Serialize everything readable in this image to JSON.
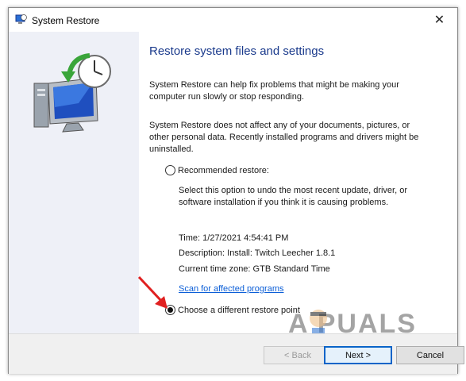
{
  "window": {
    "title": "System Restore",
    "close_glyph": "✕",
    "icon": "system-restore-icon"
  },
  "content": {
    "heading": "Restore system files and settings",
    "paragraph1": "System Restore can help fix problems that might be making your computer run slowly or stop responding.",
    "paragraph2": "System Restore does not affect any of your documents, pictures, or other personal data. Recently installed programs and drivers might be uninstalled.",
    "recommended": {
      "label": "Recommended restore:",
      "selected": false,
      "description": "Select this option to undo the most recent update, driver, or software installation if you think it is causing problems.",
      "time": "Time: 1/27/2021 4:54:41 PM",
      "desc_line": "Description: Install: Twitch Leecher 1.8.1",
      "timezone": "Current time zone: GTB Standard Time",
      "scan_link": "Scan for affected programs"
    },
    "different": {
      "label": "Choose a different restore point",
      "selected": true
    }
  },
  "buttons": {
    "back": "< Back",
    "next": "Next >",
    "cancel": "Cancel"
  },
  "watermark": {
    "text": "A  PUALS"
  },
  "colors": {
    "heading": "#1a3a8c",
    "link": "#0b5ed7",
    "next_border": "#0a64c8",
    "arrow": "#e02020",
    "panel": "#eef0f7"
  }
}
